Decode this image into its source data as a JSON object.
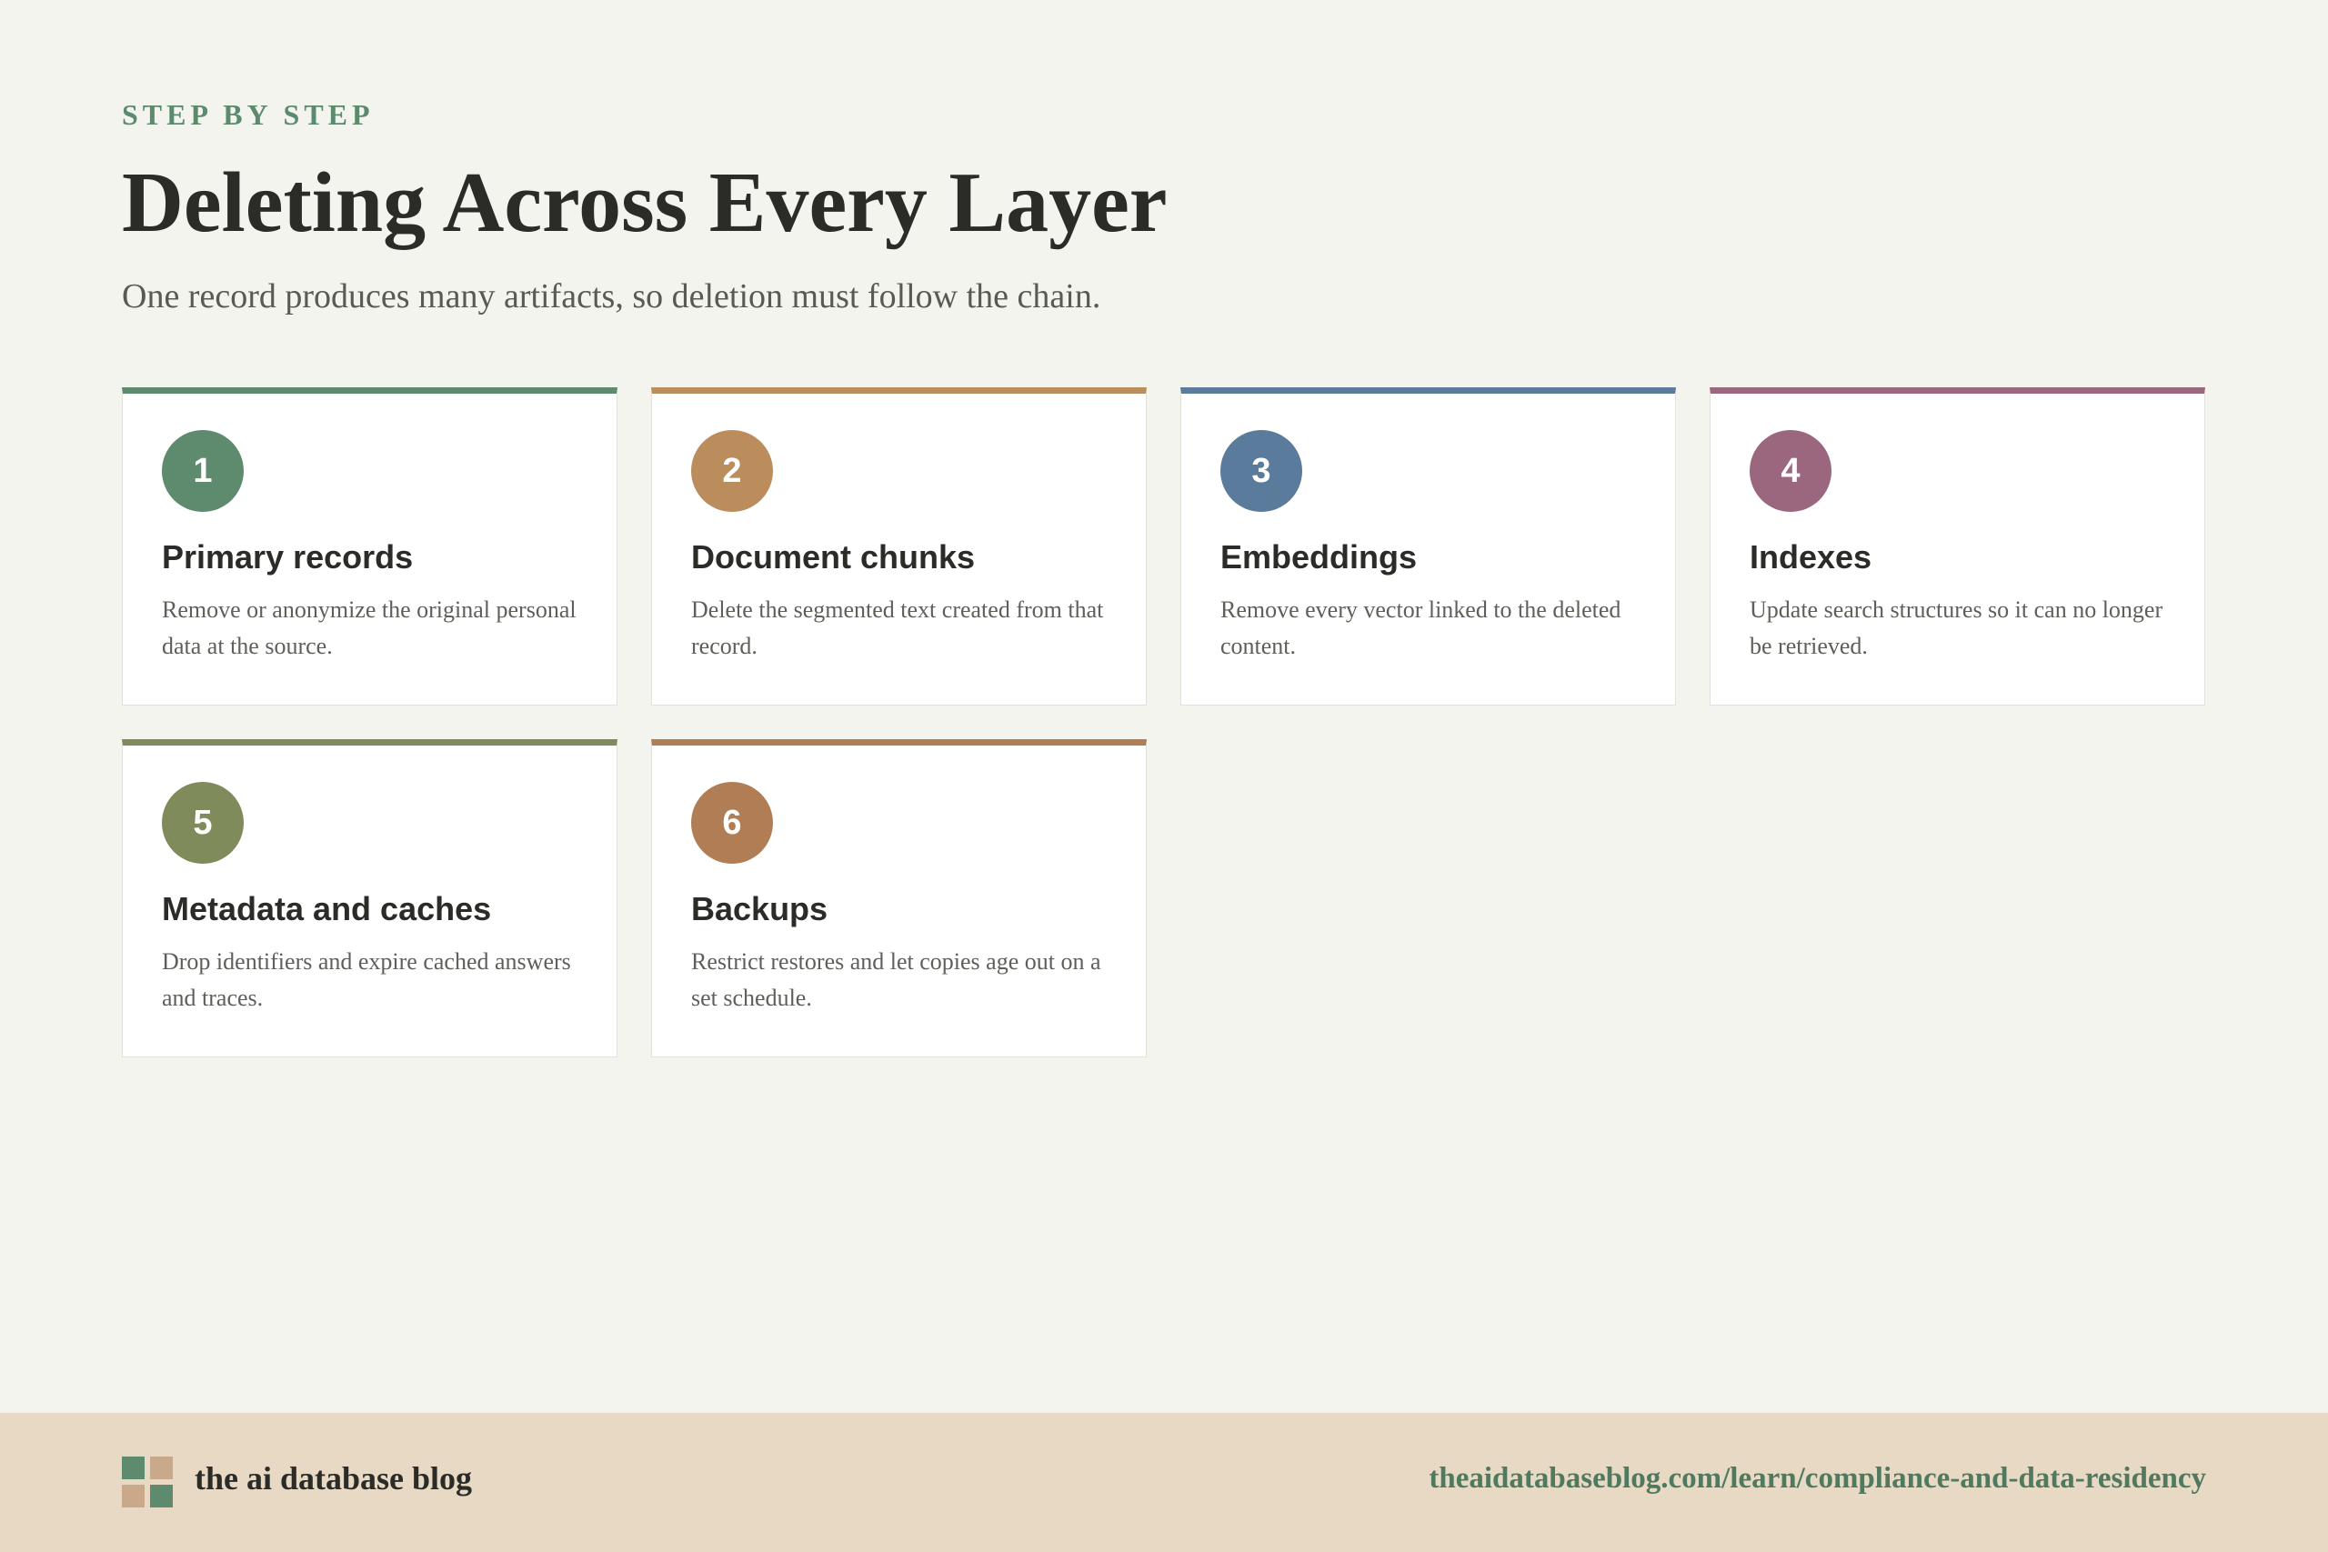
{
  "header": {
    "eyebrow": "STEP BY STEP",
    "title": "Deleting Across Every Layer",
    "subtitle": "One record produces many artifacts, so deletion must follow the chain."
  },
  "steps": [
    {
      "number": "1",
      "title": "Primary records",
      "description": "Remove or anonymize the original personal data at the source.",
      "color": "#5e8a6d"
    },
    {
      "number": "2",
      "title": "Document chunks",
      "description": "Delete the segmented text created from that record.",
      "color": "#bb8d5c"
    },
    {
      "number": "3",
      "title": "Embeddings",
      "description": "Remove every vector linked to the deleted content.",
      "color": "#5a7b9b"
    },
    {
      "number": "4",
      "title": "Indexes",
      "description": "Update search structures so it can no longer be retrieved.",
      "color": "#9a677f"
    },
    {
      "number": "5",
      "title": "Metadata and caches",
      "description": "Drop identifiers and expire cached answers and traces.",
      "color": "#7f8b5a"
    },
    {
      "number": "6",
      "title": "Backups",
      "description": "Restrict restores and let copies age out on a set schedule.",
      "color": "#b07d54"
    }
  ],
  "footer": {
    "brand": "the ai database blog",
    "url": "theaidatabaseblog.com/learn/compliance-and-data-residency",
    "logo_colors": [
      "#5e8a6d",
      "#c9a98a",
      "#c9a98a",
      "#5e8a6d"
    ]
  }
}
